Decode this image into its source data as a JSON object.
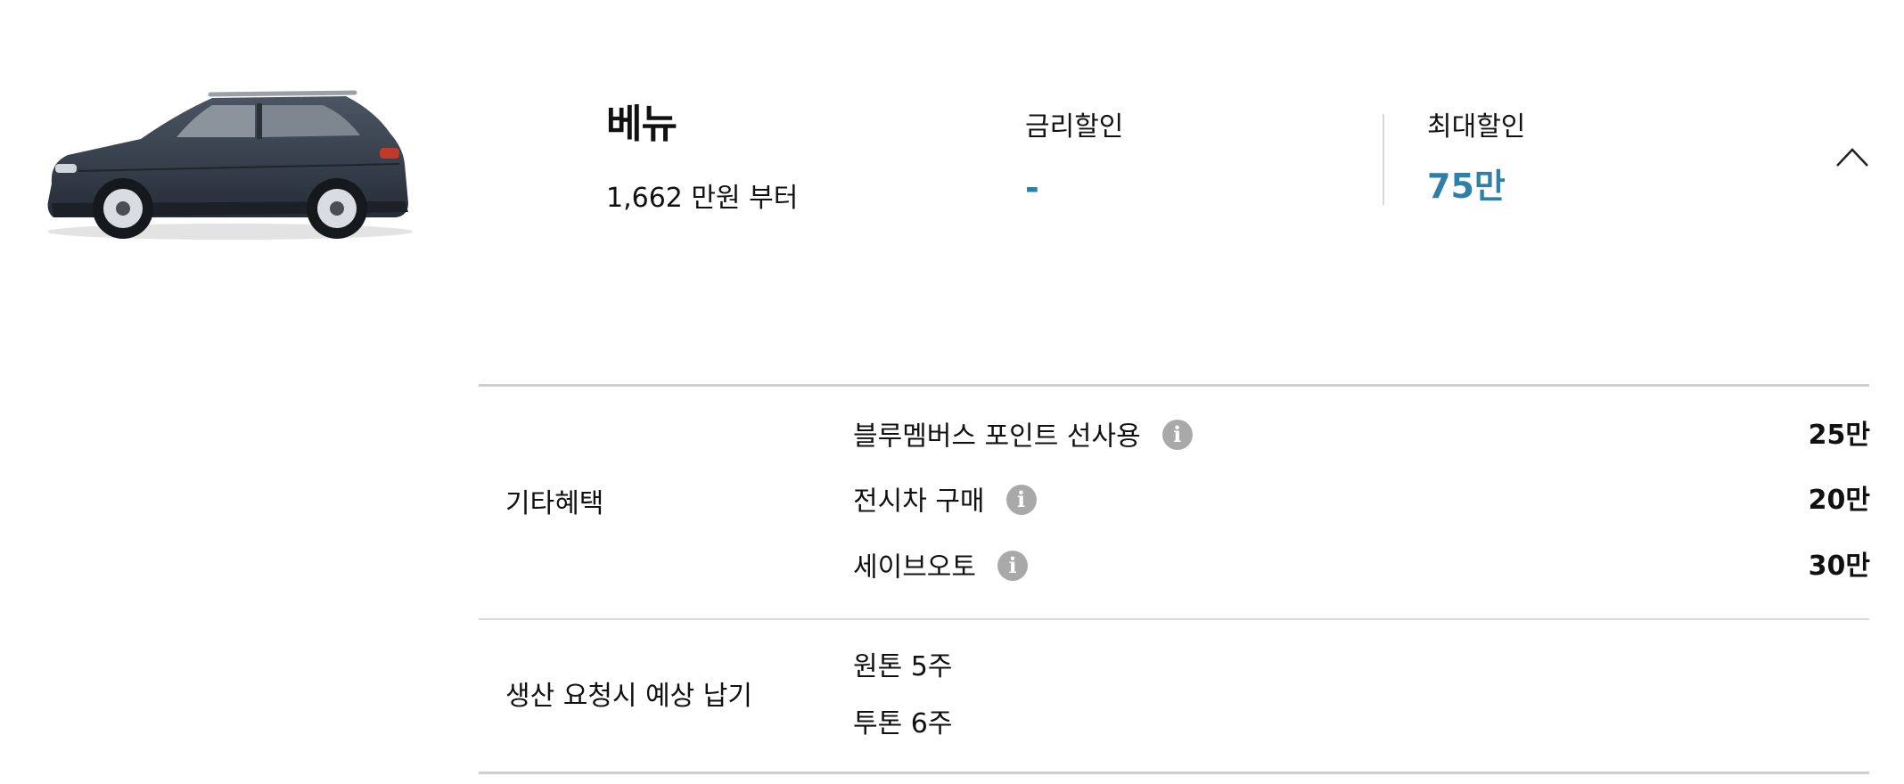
{
  "model": {
    "name": "베뉴",
    "price": "1,662 만원 부터",
    "image_icon": "car-suv-image"
  },
  "discounts": {
    "rate_label": "금리할인",
    "rate_value": "-",
    "max_label": "최대할인",
    "max_value": "75만",
    "value_color": "#2f7fa8"
  },
  "toggle": {
    "icon": "chevron-up-icon"
  },
  "benefits": {
    "section_label": "기타혜택",
    "items": [
      {
        "name": "블루멤버스 포인트 선사용",
        "amount": "25만",
        "icon": "info-icon"
      },
      {
        "name": "전시차 구매",
        "amount": "20만",
        "icon": "info-icon"
      },
      {
        "name": "세이브오토",
        "amount": "30만",
        "icon": "info-icon"
      }
    ]
  },
  "delivery": {
    "section_label": "생산 요청시 예상 납기",
    "items": [
      "원톤 5주",
      "투톤 6주"
    ]
  }
}
